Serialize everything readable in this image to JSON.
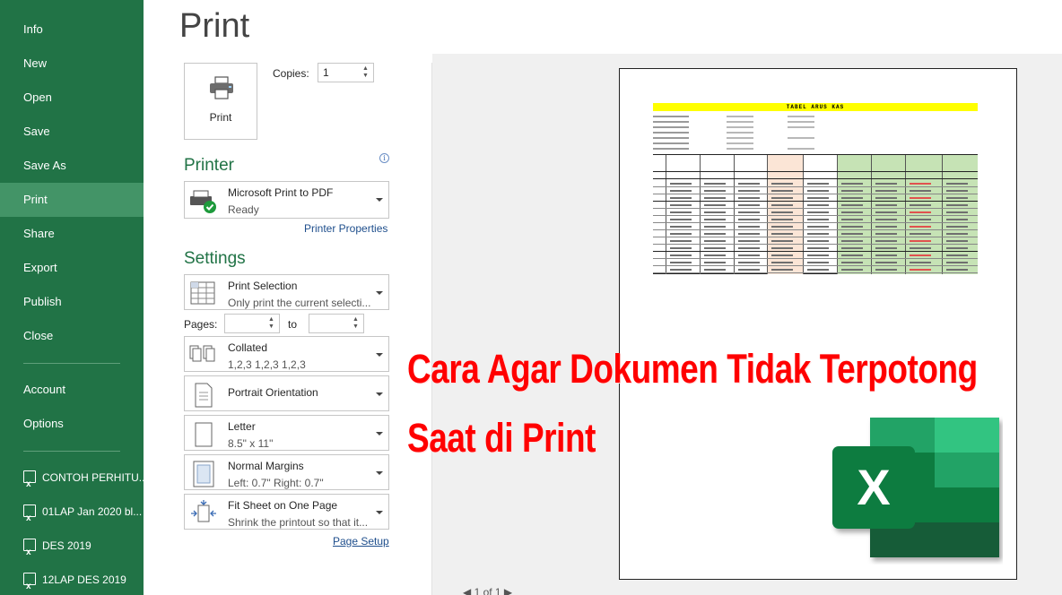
{
  "sidebar": {
    "items": [
      {
        "label": "Info"
      },
      {
        "label": "New"
      },
      {
        "label": "Open"
      },
      {
        "label": "Save"
      },
      {
        "label": "Save As"
      },
      {
        "label": "Print"
      },
      {
        "label": "Share"
      },
      {
        "label": "Export"
      },
      {
        "label": "Publish"
      },
      {
        "label": "Close"
      }
    ],
    "account": "Account",
    "options": "Options",
    "recent": [
      {
        "label": "CONTOH PERHITU..."
      },
      {
        "label": "01LAP Jan 2020 bl..."
      },
      {
        "label": "DES 2019"
      },
      {
        "label": "12LAP DES 2019"
      }
    ]
  },
  "main": {
    "title": "Print",
    "print_button": "Print",
    "copies_label": "Copies:",
    "copies_value": "1"
  },
  "printer": {
    "heading": "Printer",
    "info_glyph": "i",
    "name": "Microsoft Print to PDF",
    "status": "Ready",
    "properties_link": "Printer Properties"
  },
  "settings": {
    "heading": "Settings",
    "print_what": {
      "title": "Print Selection",
      "sub": "Only print the current selecti..."
    },
    "pages_label": "Pages:",
    "to_label": "to",
    "collate": {
      "title": "Collated",
      "sub": "1,2,3    1,2,3    1,2,3"
    },
    "orientation": {
      "title": "Portrait Orientation"
    },
    "paper": {
      "title": "Letter",
      "sub": "8.5\" x 11\""
    },
    "margins": {
      "title": "Normal Margins",
      "sub": "Left:  0.7\"    Right:  0.7\""
    },
    "scaling": {
      "title": "Fit Sheet on One Page",
      "sub": "Shrink the printout so that it..."
    },
    "page_setup_link": "Page Setup"
  },
  "preview": {
    "sheet_title": "TABEL ARUS KAS",
    "pager": "◀  1   of 1  ▶"
  },
  "overlay": {
    "line1": "Cara Agar Dokumen Tidak Terpotong",
    "line2": "Saat di Print",
    "logo_letter": "X"
  },
  "colors": {
    "brand_green": "#217346",
    "active_green": "#439467",
    "headline_red": "#ff0000",
    "sheet_yellow": "#ffff00"
  }
}
